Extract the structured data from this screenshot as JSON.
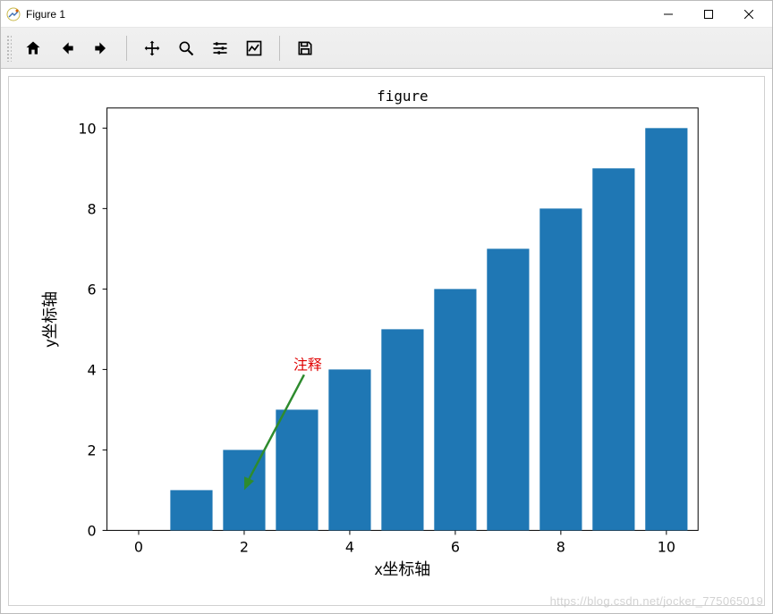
{
  "window": {
    "title": "Figure 1"
  },
  "toolbar": {
    "items": [
      "home",
      "back",
      "forward",
      "|",
      "pan",
      "zoom",
      "configure",
      "edit",
      "|",
      "save"
    ]
  },
  "chart_data": {
    "type": "bar",
    "title": "figure",
    "xlabel": "x坐标轴",
    "ylabel": "y坐标轴",
    "xticks": [
      0,
      2,
      4,
      6,
      8,
      10
    ],
    "yticks": [
      0,
      2,
      4,
      6,
      8,
      10
    ],
    "xlim": [
      -0.6,
      10.6
    ],
    "ylim": [
      0,
      10.5
    ],
    "categories": [
      1,
      2,
      3,
      4,
      5,
      6,
      7,
      8,
      9,
      10
    ],
    "values": [
      1,
      2,
      3,
      4,
      5,
      6,
      7,
      8,
      9,
      10
    ],
    "bar_color": "#1f77b4",
    "annotation": {
      "text": "注释",
      "text_xy": [
        3,
        4
      ],
      "arrow_to_xy": [
        2,
        1
      ],
      "text_color": "#e00000",
      "arrow_color": "#2e8b2e"
    }
  },
  "watermark": "https://blog.csdn.net/jocker_775065019"
}
